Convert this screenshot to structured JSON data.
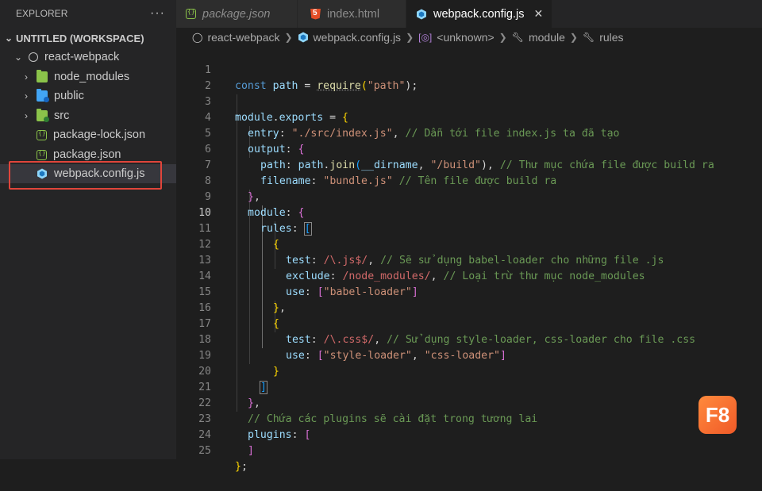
{
  "explorer": {
    "title": "EXPLORER",
    "more": "···",
    "workspace": "UNTITLED (WORKSPACE)",
    "project": "react-webpack",
    "items": [
      {
        "label": "node_modules",
        "type": "folder"
      },
      {
        "label": "public",
        "type": "folder"
      },
      {
        "label": "src",
        "type": "folder"
      },
      {
        "label": "package-lock.json",
        "type": "file"
      },
      {
        "label": "package.json",
        "type": "file"
      },
      {
        "label": "webpack.config.js",
        "type": "file"
      }
    ]
  },
  "tabs": [
    {
      "label": "package.json",
      "icon": "json-icon"
    },
    {
      "label": "index.html",
      "icon": "html-icon"
    },
    {
      "label": "webpack.config.js",
      "icon": "webpack-icon",
      "close": "✕"
    }
  ],
  "breadcrumb": [
    "react-webpack",
    "webpack.config.js",
    "<unknown>",
    "module",
    "rules"
  ],
  "editor": {
    "line_numbers": [
      "1",
      "2",
      "3",
      "4",
      "5",
      "6",
      "7",
      "8",
      "9",
      "10",
      "11",
      "12",
      "13",
      "14",
      "15",
      "16",
      "17",
      "18",
      "19",
      "20",
      "21",
      "22",
      "23",
      "24",
      "25"
    ],
    "current_line": "10",
    "tokens": {
      "l1": [
        "const",
        " path",
        " = ",
        "require",
        "(",
        "\"path\"",
        ");"
      ],
      "l3": [
        "module",
        ".",
        "exports",
        " = ",
        "{"
      ],
      "l4": [
        "entry",
        ": ",
        "\"./src/index.js\"",
        ", ",
        "// Dẫn tới file index.js ta đã tạo"
      ],
      "l5": [
        "output",
        ": ",
        "{"
      ],
      "l6": [
        "path",
        ": ",
        "path",
        ".",
        "join",
        "(",
        "__dirname",
        ", ",
        "\"/build\"",
        "), ",
        "// Thư mục chứa file được build ra"
      ],
      "l7": [
        "filename",
        ": ",
        "\"bundle.js\"",
        " ",
        "// Tên file được build ra"
      ],
      "l8": [
        "}",
        ","
      ],
      "l9": [
        "module",
        ": ",
        "{"
      ],
      "l10": [
        "rules",
        ": ",
        "["
      ],
      "l11": [
        "{"
      ],
      "l12": [
        "test",
        ": ",
        "/\\.js$/",
        ", ",
        "// Sẽ sử dụng babel-loader cho những file .js"
      ],
      "l13": [
        "exclude",
        ": ",
        "/node_modules/",
        ", ",
        "// Loại trừ thư mục node_modules"
      ],
      "l14": [
        "use",
        ": ",
        "[",
        "\"babel-loader\"",
        "]"
      ],
      "l15": [
        "}",
        ","
      ],
      "l16": [
        "{"
      ],
      "l17": [
        "test",
        ": ",
        "/\\.css$/",
        ", ",
        "// Sử dụng style-loader, css-loader cho file .css"
      ],
      "l18": [
        "use",
        ": ",
        "[",
        "\"style-loader\"",
        ", ",
        "\"css-loader\"",
        "]"
      ],
      "l19": [
        "}"
      ],
      "l20": [
        "]"
      ],
      "l21": [
        "}",
        ","
      ],
      "l22": [
        "// Chứa các plugins sẽ cài đặt trong tương lai"
      ],
      "l23": [
        "plugins",
        ": ",
        "["
      ],
      "l24": [
        "]"
      ],
      "l25": [
        "}",
        ";"
      ]
    }
  },
  "logo": "F8",
  "colors": {
    "highlight": "#e0453b",
    "accent_logo": "#f05a28"
  }
}
